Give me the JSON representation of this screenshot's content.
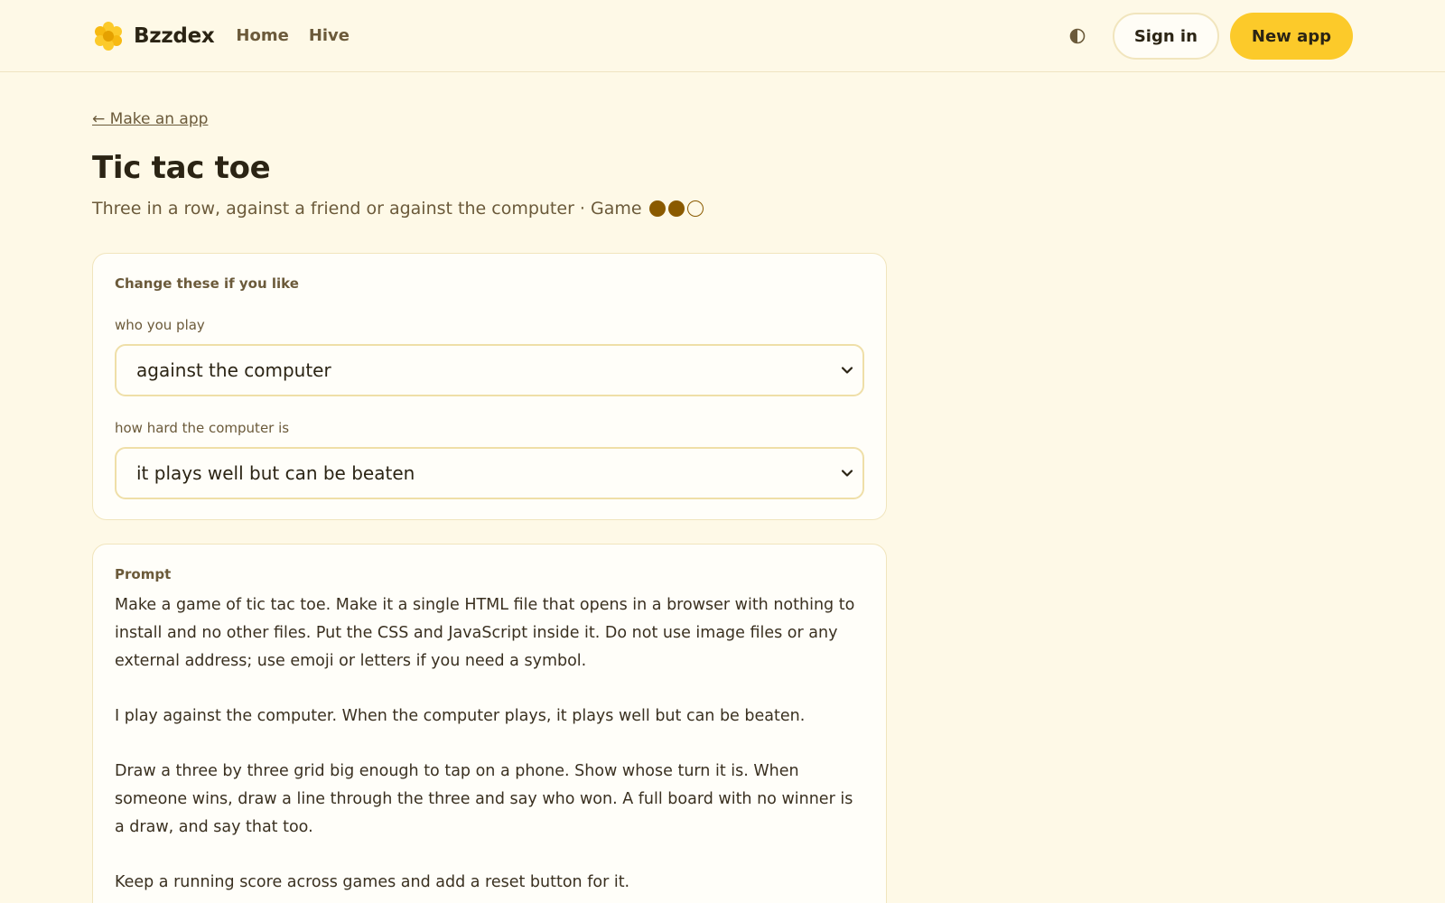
{
  "header": {
    "brand": "Bzzdex",
    "nav": [
      {
        "label": "Home"
      },
      {
        "label": "Hive"
      }
    ],
    "sign_in_label": "Sign in",
    "new_app_label": "New app",
    "theme_icon": "contrast-icon",
    "logo_icon": "honeycomb-logo-icon"
  },
  "page": {
    "back_link": "← Make an app",
    "title": "Tic tac toe",
    "subtitle": "Three in a row, against a friend or against the computer · Game",
    "difficulty": {
      "filled": 2,
      "total": 3
    }
  },
  "options": {
    "heading": "Change these if you like",
    "who_label": "who you play",
    "who_value": "against the computer",
    "hard_label": "how hard the computer is",
    "hard_value": "it plays well but can be beaten"
  },
  "prompt": {
    "heading": "Prompt",
    "paragraphs": [
      "Make a game of tic tac toe. Make it a single HTML file that opens in a browser with nothing to install and no other files. Put the CSS and JavaScript inside it. Do not use image files or any external address; use emoji or letters if you need a symbol.",
      "I play against the computer. When the computer plays, it plays well but can be beaten.",
      "Draw a three by three grid big enough to tap on a phone. Show whose turn it is. When someone wins, draw a line through the three and say who won. A full board with no winner is a draw, and say that too.",
      "Keep a running score across games and add a reset button for it."
    ]
  },
  "colors": {
    "background": "#fef9e7",
    "accent": "#fcca2a",
    "dot": "#8a5a00"
  }
}
